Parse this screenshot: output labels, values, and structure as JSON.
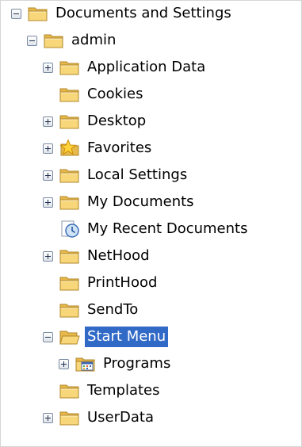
{
  "tree": {
    "rows": [
      {
        "label": "Documents and Settings",
        "expander": "minus",
        "icon": "folder-icon",
        "level": 0
      },
      {
        "label": "admin",
        "expander": "minus",
        "icon": "folder-icon",
        "level": 1
      },
      {
        "label": "Application Data",
        "expander": "plus",
        "icon": "folder-icon",
        "level": 2
      },
      {
        "label": "Cookies",
        "expander": "none",
        "icon": "folder-icon",
        "level": 2
      },
      {
        "label": "Desktop",
        "expander": "plus",
        "icon": "folder-icon",
        "level": 2
      },
      {
        "label": "Favorites",
        "expander": "plus",
        "icon": "star-folder-icon",
        "level": 2
      },
      {
        "label": "Local Settings",
        "expander": "plus",
        "icon": "folder-icon",
        "level": 2
      },
      {
        "label": "My Documents",
        "expander": "plus",
        "icon": "folder-icon",
        "level": 2
      },
      {
        "label": "My Recent Documents",
        "expander": "none",
        "icon": "recent-documents-icon",
        "level": 2
      },
      {
        "label": "NetHood",
        "expander": "plus",
        "icon": "folder-icon",
        "level": 2
      },
      {
        "label": "PrintHood",
        "expander": "none",
        "icon": "folder-icon",
        "level": 2
      },
      {
        "label": "SendTo",
        "expander": "none",
        "icon": "folder-icon",
        "level": 2
      },
      {
        "label": "Start Menu",
        "expander": "minus",
        "icon": "open-folder-icon",
        "level": 2,
        "selected": true
      },
      {
        "label": "Programs",
        "expander": "plus",
        "icon": "programs-folder-icon",
        "level": 3
      },
      {
        "label": "Templates",
        "expander": "none",
        "icon": "folder-icon",
        "level": 2
      },
      {
        "label": "UserData",
        "expander": "plus",
        "icon": "folder-icon",
        "level": 2
      }
    ],
    "selection_color": "#3169c6"
  }
}
